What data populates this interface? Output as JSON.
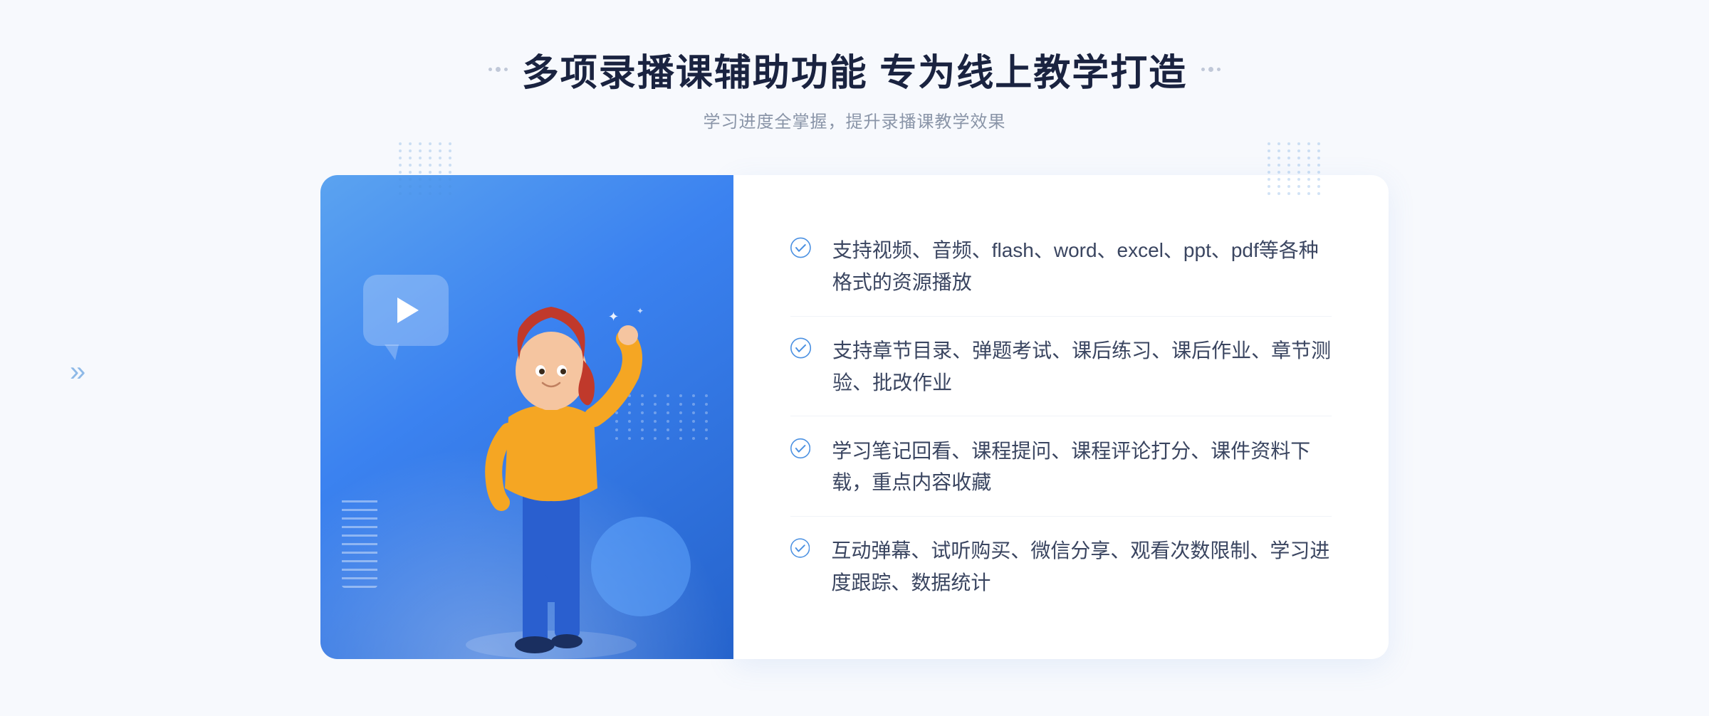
{
  "header": {
    "title": "多项录播课辅助功能 专为线上教学打造",
    "subtitle": "学习进度全掌握，提升录播课教学效果",
    "decorator_left": "⠿",
    "decorator_right": "⠿"
  },
  "features": [
    {
      "id": 1,
      "text": "支持视频、音频、flash、word、excel、ppt、pdf等各种格式的资源播放"
    },
    {
      "id": 2,
      "text": "支持章节目录、弹题考试、课后练习、课后作业、章节测验、批改作业"
    },
    {
      "id": 3,
      "text": "学习笔记回看、课程提问、课程评论打分、课件资料下载，重点内容收藏"
    },
    {
      "id": 4,
      "text": "互动弹幕、试听购买、微信分享、观看次数限制、学习进度跟踪、数据统计"
    }
  ],
  "colors": {
    "primary_blue": "#3b82f0",
    "light_blue": "#5ba3f0",
    "dark_blue": "#2563cc",
    "text_dark": "#1a2340",
    "text_medium": "#3a4560",
    "text_light": "#8a95a8",
    "check_color": "#4a90e2",
    "bg_light": "#f7f9fd"
  }
}
